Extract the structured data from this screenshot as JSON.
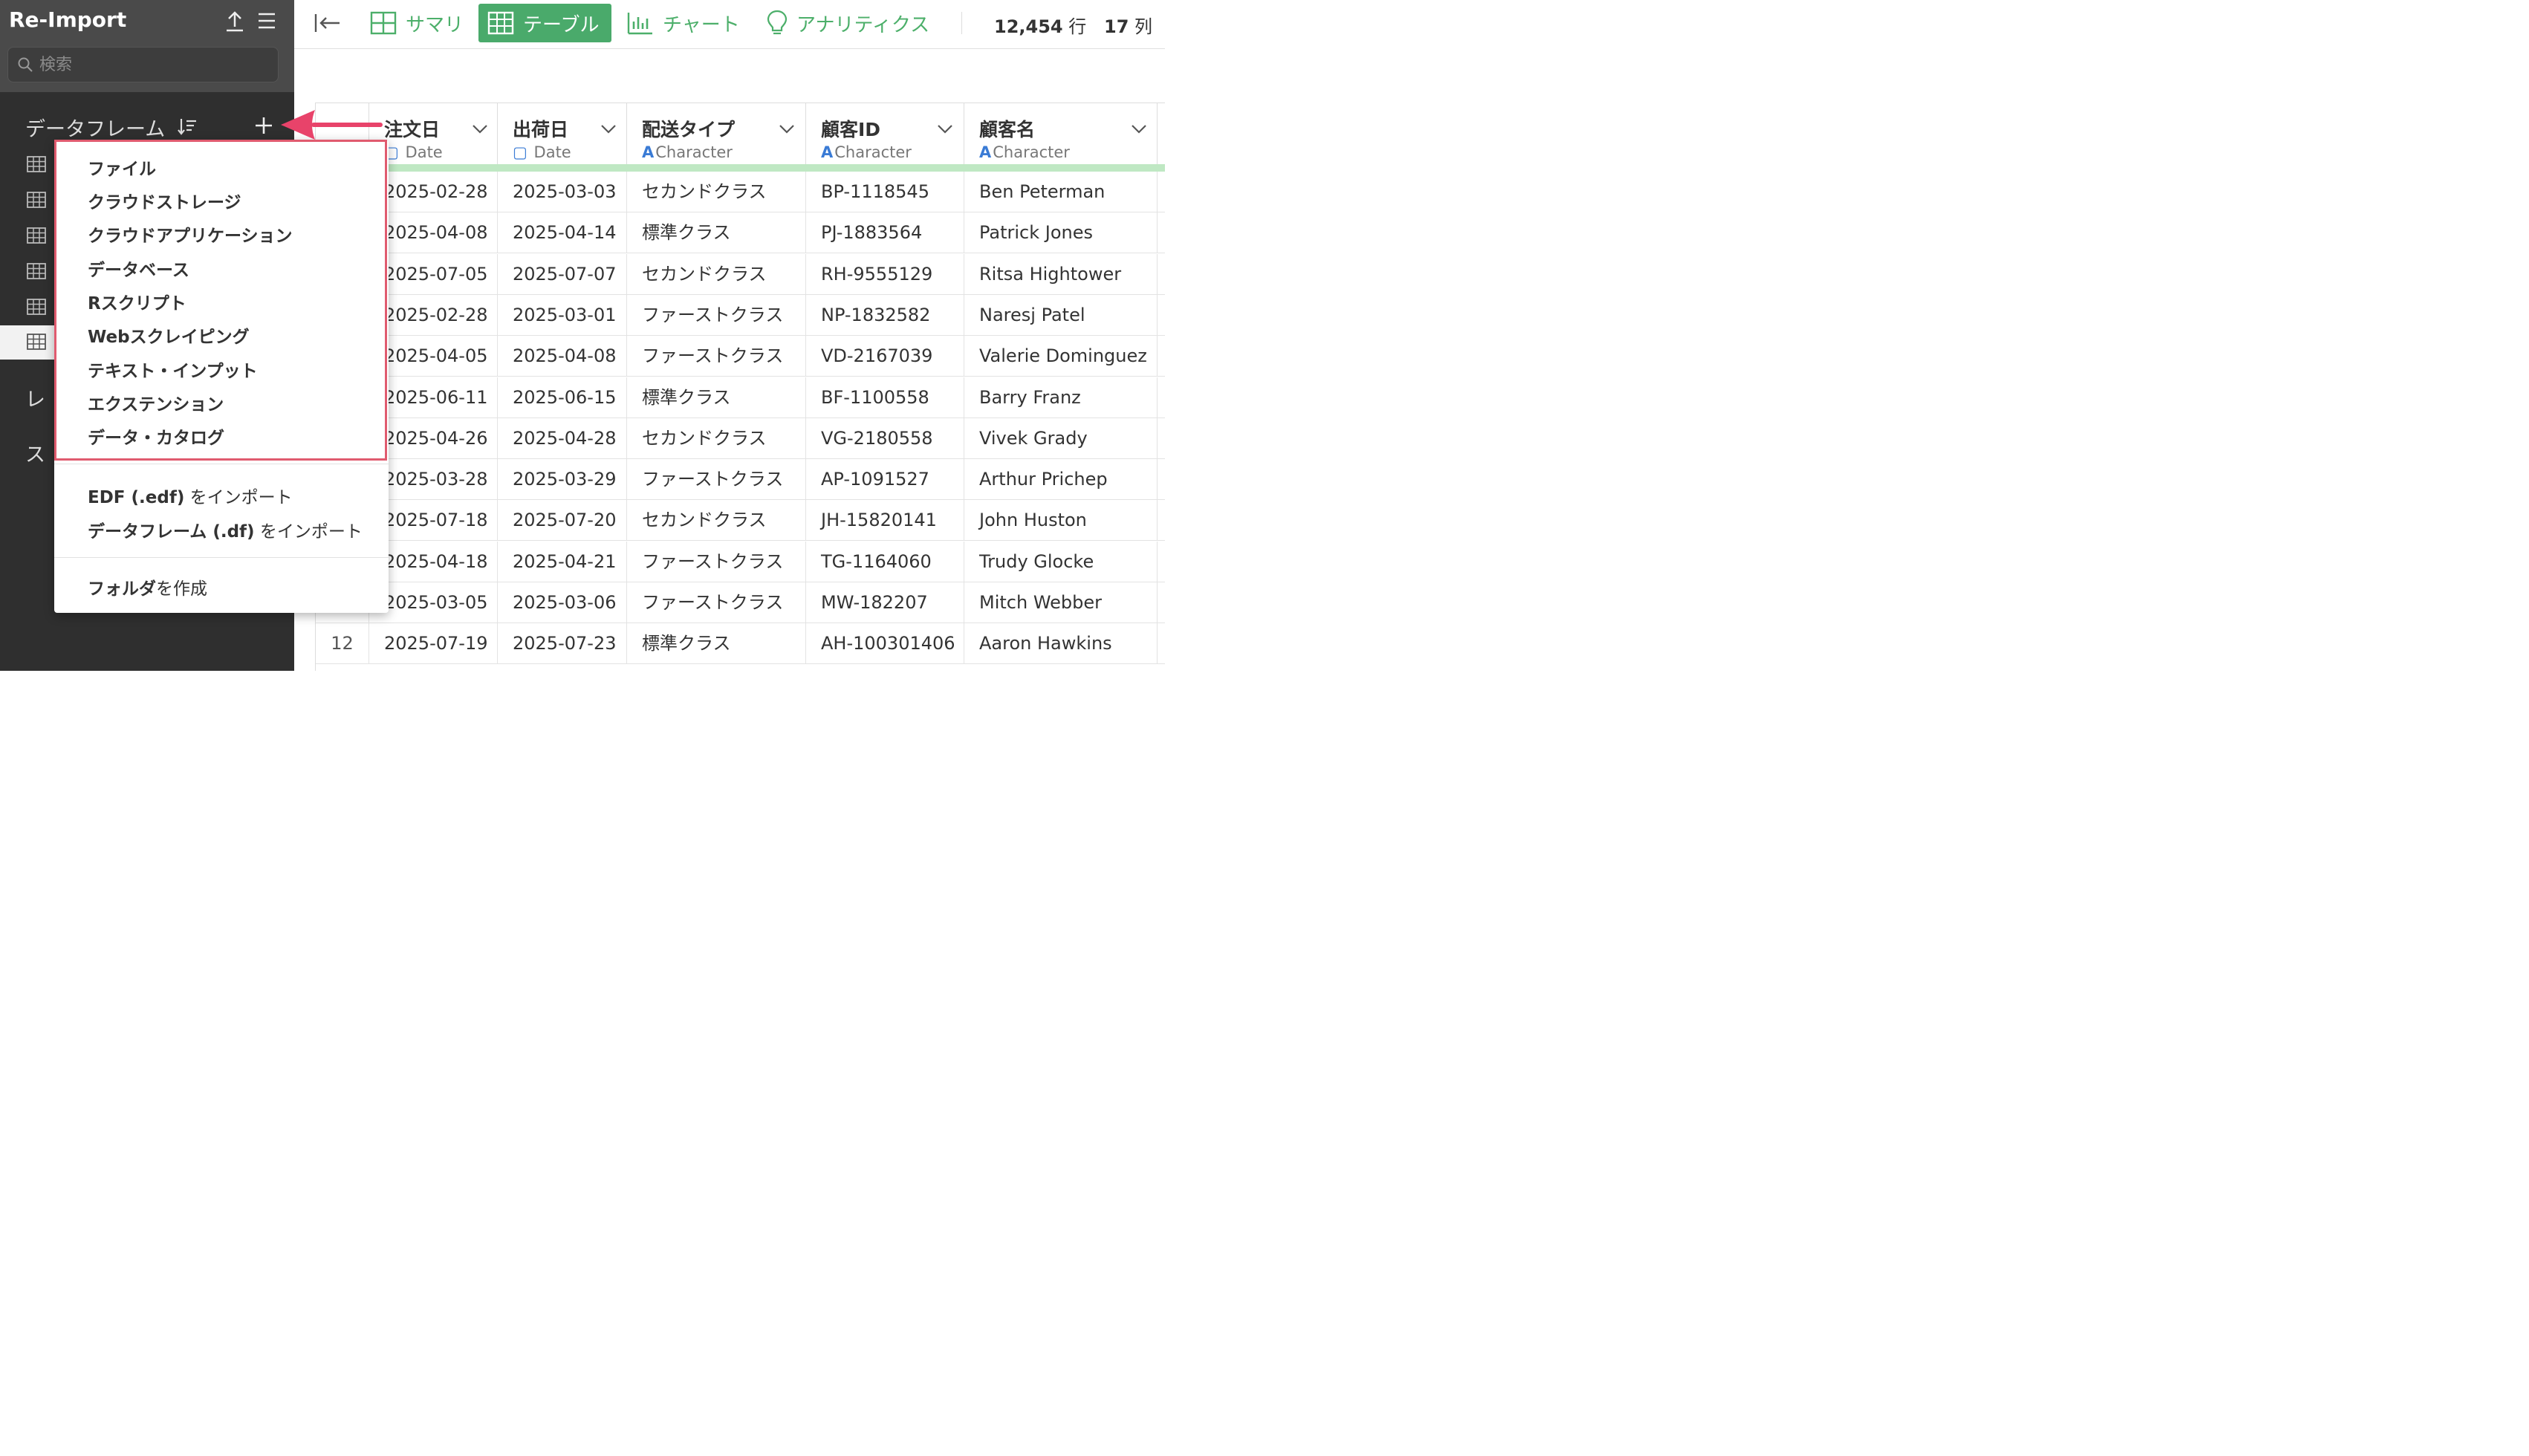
{
  "sidebar": {
    "title": "Re-Import",
    "search_placeholder": "検索",
    "section_dataframes": "データフレーム",
    "section_reports": "レ",
    "section_scripts": "ス"
  },
  "toolbar": {
    "tabs": [
      {
        "label": "サマリ",
        "icon": "summary-icon"
      },
      {
        "label": "テーブル",
        "icon": "table-icon",
        "active": true
      },
      {
        "label": "チャート",
        "icon": "chart-icon"
      },
      {
        "label": "アナリティクス",
        "icon": "lightbulb-icon"
      }
    ],
    "rows_count": "12,454",
    "rows_unit": "行",
    "cols_count": "17",
    "cols_unit": "列"
  },
  "table": {
    "columns": [
      {
        "name": "注文日",
        "type_mark": "▢",
        "type": "Date"
      },
      {
        "name": "出荷日",
        "type_mark": "▢",
        "type": "Date"
      },
      {
        "name": "配送タイプ",
        "type_mark": "A",
        "type": "Character"
      },
      {
        "name": "顧客ID",
        "type_mark": "A",
        "type": "Character"
      },
      {
        "name": "顧客名",
        "type_mark": "A",
        "type": "Character"
      }
    ],
    "rows": [
      {
        "idx": "",
        "c0": "2025-02-28",
        "c1": "2025-03-03",
        "c2": "セカンドクラス",
        "c3": "BP-1118545",
        "c4": "Ben Peterman"
      },
      {
        "idx": "",
        "c0": "2025-04-08",
        "c1": "2025-04-14",
        "c2": "標準クラス",
        "c3": "PJ-1883564",
        "c4": "Patrick Jones"
      },
      {
        "idx": "",
        "c0": "2025-07-05",
        "c1": "2025-07-07",
        "c2": "セカンドクラス",
        "c3": "RH-9555129",
        "c4": "Ritsa Hightower"
      },
      {
        "idx": "",
        "c0": "2025-02-28",
        "c1": "2025-03-01",
        "c2": "ファーストクラス",
        "c3": "NP-1832582",
        "c4": "Naresj Patel"
      },
      {
        "idx": "",
        "c0": "2025-04-05",
        "c1": "2025-04-08",
        "c2": "ファーストクラス",
        "c3": "VD-2167039",
        "c4": "Valerie Dominguez"
      },
      {
        "idx": "",
        "c0": "2025-06-11",
        "c1": "2025-06-15",
        "c2": "標準クラス",
        "c3": "BF-1100558",
        "c4": "Barry Franz"
      },
      {
        "idx": "",
        "c0": "2025-04-26",
        "c1": "2025-04-28",
        "c2": "セカンドクラス",
        "c3": "VG-2180558",
        "c4": "Vivek Grady"
      },
      {
        "idx": "",
        "c0": "2025-03-28",
        "c1": "2025-03-29",
        "c2": "ファーストクラス",
        "c3": "AP-1091527",
        "c4": "Arthur Prichep"
      },
      {
        "idx": "",
        "c0": "2025-07-18",
        "c1": "2025-07-20",
        "c2": "セカンドクラス",
        "c3": "JH-15820141",
        "c4": "John Huston"
      },
      {
        "idx": "",
        "c0": "2025-04-18",
        "c1": "2025-04-21",
        "c2": "ファーストクラス",
        "c3": "TG-1164060",
        "c4": "Trudy Glocke"
      },
      {
        "idx": "",
        "c0": "2025-03-05",
        "c1": "2025-03-06",
        "c2": "ファーストクラス",
        "c3": "MW-182207",
        "c4": "Mitch Webber"
      },
      {
        "idx": "12",
        "c0": "2025-07-19",
        "c1": "2025-07-23",
        "c2": "標準クラス",
        "c3": "AH-100301406",
        "c4": "Aaron Hawkins"
      }
    ]
  },
  "dropdown": {
    "items": [
      "ファイル",
      "クラウドストレージ",
      "クラウドアプリケーション",
      "データベース",
      "Rスクリプト",
      "Webスクレイピング",
      "テキスト・インプット",
      "エクステンション",
      "データ・カタログ"
    ],
    "import_edf_bold": "EDF (.edf)",
    "import_edf_rest": " をインポート",
    "import_df_bold": "データフレーム (.df)",
    "import_df_rest": " をインポート",
    "folder_bold": "フォルダ",
    "folder_rest": "を作成"
  },
  "colors": {
    "accent_green": "#4aaa6b",
    "highlight_red": "#e05b6f",
    "arrow_pink": "#e8436a",
    "sidebar_bg": "#2f2f2f"
  }
}
